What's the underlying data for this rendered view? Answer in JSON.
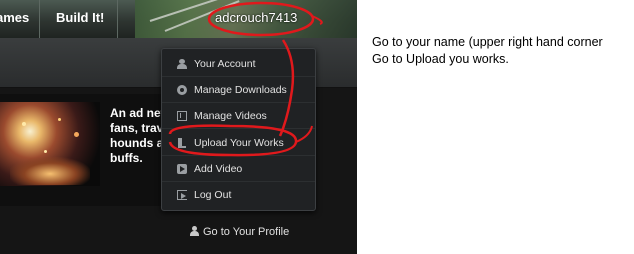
{
  "nav": {
    "items": [
      {
        "label": "ames"
      },
      {
        "label": "Build It!"
      }
    ],
    "username": "adcrouch7413"
  },
  "content": {
    "blurb_lines": [
      "An ad net",
      "fans, trav",
      "hounds a",
      "buffs."
    ],
    "profile_link": "Go to Your Profile"
  },
  "dropdown": {
    "items": [
      {
        "label": "Your Account",
        "icon": "user-icon"
      },
      {
        "label": "Manage Downloads",
        "icon": "gear-icon"
      },
      {
        "label": "Manage Videos",
        "icon": "film-icon"
      },
      {
        "label": "Upload Your Works",
        "icon": "upload-icon"
      },
      {
        "label": "Add Video",
        "icon": "play-icon"
      },
      {
        "label": "Log Out",
        "icon": "logout-icon"
      }
    ]
  },
  "instructions": {
    "line1": "Go to your name (upper right hand corner",
    "line2": "Go to Upload you works."
  },
  "colors": {
    "annotation": "#e0191c",
    "dropdown_bg": "#202224",
    "page_bg": "#ffffff"
  }
}
